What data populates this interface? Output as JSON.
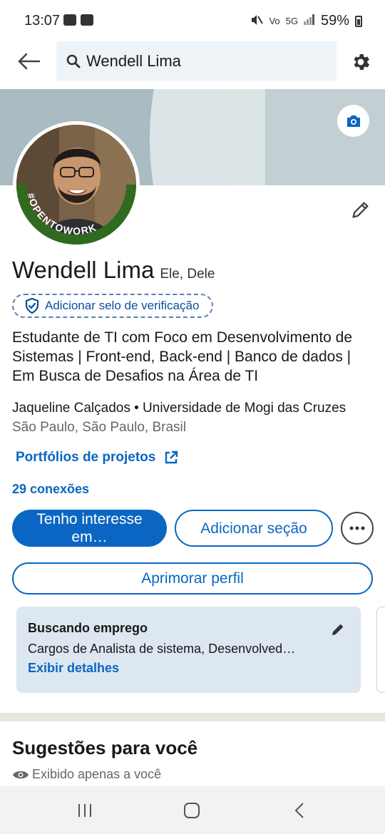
{
  "status_bar": {
    "time": "13:07",
    "network": "5G",
    "battery": "59%",
    "icons": [
      "image-icon",
      "youtube-icon",
      "mute-icon",
      "volte-icon",
      "signal-icon",
      "battery-icon"
    ]
  },
  "search": {
    "query": "Wendell Lima"
  },
  "profile": {
    "name": "Wendell Lima",
    "pronouns": "Ele, Dele",
    "verify_label": "Adicionar selo de verificação",
    "headline": "Estudante de TI com Foco em Desenvolvimento de Sistemas | Front-end, Back-end | Banco de dados | Em Busca de Desafios na Área de TI",
    "company_line": "Jaqueline Calçados • Universidade de Mogi das Cruzes",
    "location": "São Paulo, São Paulo, Brasil",
    "website_label": "Portfólios de projetos",
    "connections": "29 conexões",
    "badge_text": "#OPENTOWORK"
  },
  "actions": {
    "open_to": "Tenho interesse em…",
    "add_section": "Adicionar seção",
    "enhance": "Aprimorar perfil"
  },
  "open_to_work": {
    "title": "Buscando emprego",
    "description": "Cargos de Analista de sistema, Desenvolved…",
    "link": "Exibir detalhes"
  },
  "suggestions": {
    "title": "Sugestões para você",
    "private_note": "Exibido apenas a você"
  },
  "colors": {
    "primary": "#0a66c2",
    "otw_green": "#2f6b1f",
    "card_bg": "#dde7f1"
  }
}
